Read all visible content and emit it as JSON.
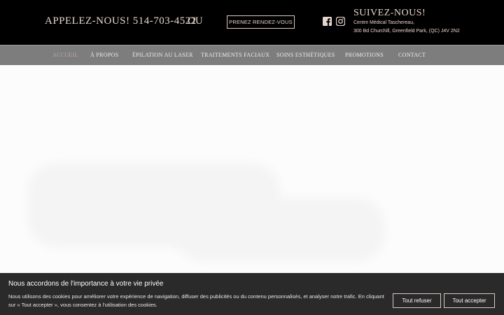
{
  "header": {
    "call_label": "APPELEZ-NOUS! 514-703-4522",
    "or_label": "OU",
    "appointment_button": "PRENEZ RENDEZ-VOUS",
    "follow_label": "SUIVEZ-NOUS!",
    "address_line1": "Centre Médical Taschereau,",
    "address_line2": "300 Bd Churchill, Greenfield Park, (QC) J4V 2N2",
    "social_icons": [
      "facebook-icon",
      "instagram-icon"
    ]
  },
  "nav": {
    "items": [
      {
        "label": "ACCUEIL"
      },
      {
        "label": "À PROPOS"
      },
      {
        "label": "ÉPILATION AU LASER"
      },
      {
        "label": "TRAITEMENTS FACIAUX"
      },
      {
        "label": "SOINS ESTHÉTIQUES"
      },
      {
        "label": "PROMOTIONS"
      },
      {
        "label": "CONTACT"
      }
    ]
  },
  "cookie": {
    "title": "Nous accordons de l'importance à votre vie privée",
    "text": "Nous utilisons des cookies pour améliorer votre expérience de navigation, diffuser des publicités ou du contenu personnalisés, et analyser notre trafic. En cliquant sur « Tout accepter », vous consentez à l'utilisation des cookies.",
    "refuse_label": "Tout refuser",
    "accept_label": "Tout accepter"
  },
  "colors": {
    "topbar_bg": "#000000",
    "nav_bg": "#7d7d7d",
    "accent_text": "#e6d4cd",
    "cookie_bg": "#2a2a2a"
  }
}
